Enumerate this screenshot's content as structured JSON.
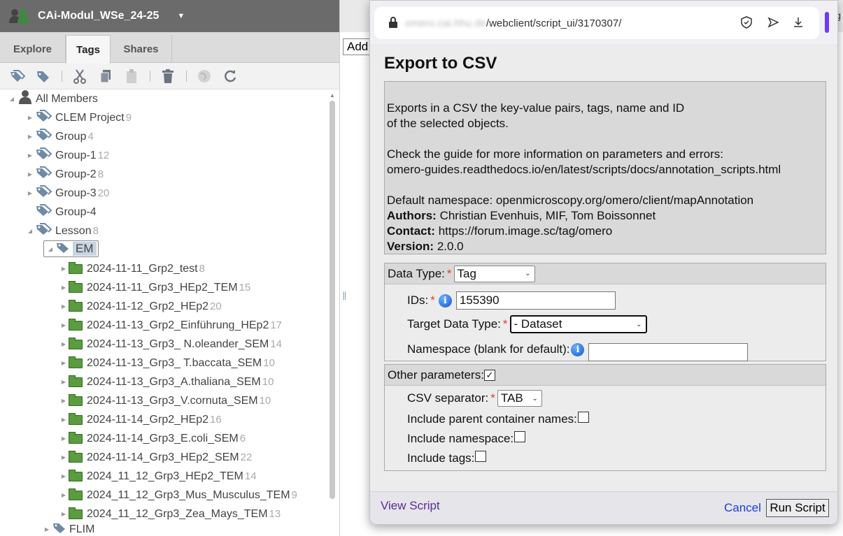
{
  "left_panel": {
    "group_name": "CAi-Modul_WSe_24-25",
    "tabs": [
      "Explore",
      "Tags",
      "Shares"
    ],
    "active_tab": "Tags",
    "tree": {
      "root": "All Members",
      "items": [
        {
          "label": "CLEM Project",
          "count": "9"
        },
        {
          "label": "Group",
          "count": "4"
        },
        {
          "label": "Group-1",
          "count": "12"
        },
        {
          "label": "Group-2",
          "count": "8"
        },
        {
          "label": "Group-3",
          "count": "20"
        },
        {
          "label": "Group-4",
          "count": ""
        },
        {
          "label": "Lesson",
          "count": "8"
        },
        {
          "label": "EM",
          "count": ""
        }
      ],
      "datasets": [
        {
          "label": "2024-11-11_Grp2_test",
          "count": "8"
        },
        {
          "label": "2024-11-11_Grp3_HEp2_TEM",
          "count": "15"
        },
        {
          "label": "2024-11-12_Grp2_HEp2",
          "count": "20"
        },
        {
          "label": "2024-11-13_Grp2_Einführung_HEp2",
          "count": "17"
        },
        {
          "label": "2024-11-13_Grp3_ N.oleander_SEM",
          "count": "14"
        },
        {
          "label": "2024-11-13_Grp3_ T.baccata_SEM",
          "count": "10"
        },
        {
          "label": "2024-11-13_Grp3_A.thaliana_SEM",
          "count": "10"
        },
        {
          "label": "2024-11-13_Grp3_V.cornuta_SEM",
          "count": "10"
        },
        {
          "label": "2024-11-14_Grp2_HEp2",
          "count": "16"
        },
        {
          "label": "2024-11-14_Grp3_E.coli_SEM",
          "count": "6"
        },
        {
          "label": "2024-11-14_Grp3_HEp2_SEM",
          "count": "22"
        },
        {
          "label": "2024_11_12_Grp3_HEp2_TEM",
          "count": "14"
        },
        {
          "label": "2024_11_12_Grp3_Mus_Musculus_TEM",
          "count": "9"
        },
        {
          "label": "2024_11_12_Grp3_Zea_Mays_TEM",
          "count": "13"
        }
      ],
      "last_item": "FLIM"
    }
  },
  "middle": {
    "add_label": "Add",
    "right_edge_text": "Tag"
  },
  "popup": {
    "url_host": "omero.cai.hhu.de",
    "url_path": "/webclient/script_ui/3170307/",
    "title": "Export to CSV",
    "desc": {
      "line1": "Exports in a CSV the key-value pairs, tags, name and ID",
      "line2": "of the selected objects.",
      "line3": "Check the guide for more information on parameters and errors:",
      "line4": "omero-guides.readthedocs.io/en/latest/scripts/docs/annotation_scripts.html",
      "line5": "Default namespace: openmicroscopy.org/omero/client/mapAnnotation",
      "authors_label": "Authors:",
      "authors": "Christian Evenhuis, MIF, Tom Boissonnet",
      "contact_label": "Contact:",
      "contact": "https://forum.image.sc/tag/omero",
      "version_label": "Version:",
      "version": "2.0.0"
    },
    "data_type": {
      "label": "Data Type:",
      "value": "Tag"
    },
    "ids": {
      "label": "IDs:",
      "value": "155390"
    },
    "target": {
      "label": "Target Data Type:",
      "value": "- Dataset"
    },
    "namespace": {
      "label": "Namespace (blank for default):",
      "value": ""
    },
    "other": {
      "label": "Other parameters:",
      "checked": true
    },
    "csv_sep": {
      "label": "CSV separator:",
      "value": "TAB"
    },
    "parent_names": {
      "label": "Include parent container names:"
    },
    "include_ns": {
      "label": "Include namespace:"
    },
    "include_tags": {
      "label": "Include tags:"
    },
    "footer": {
      "view_script": "View Script",
      "cancel": "Cancel",
      "run": "Run Script"
    },
    "colors": {
      "accent_purple": "#6c3bf5",
      "link_blue": "#1a3fd6",
      "required_red": "#dd4422"
    }
  }
}
